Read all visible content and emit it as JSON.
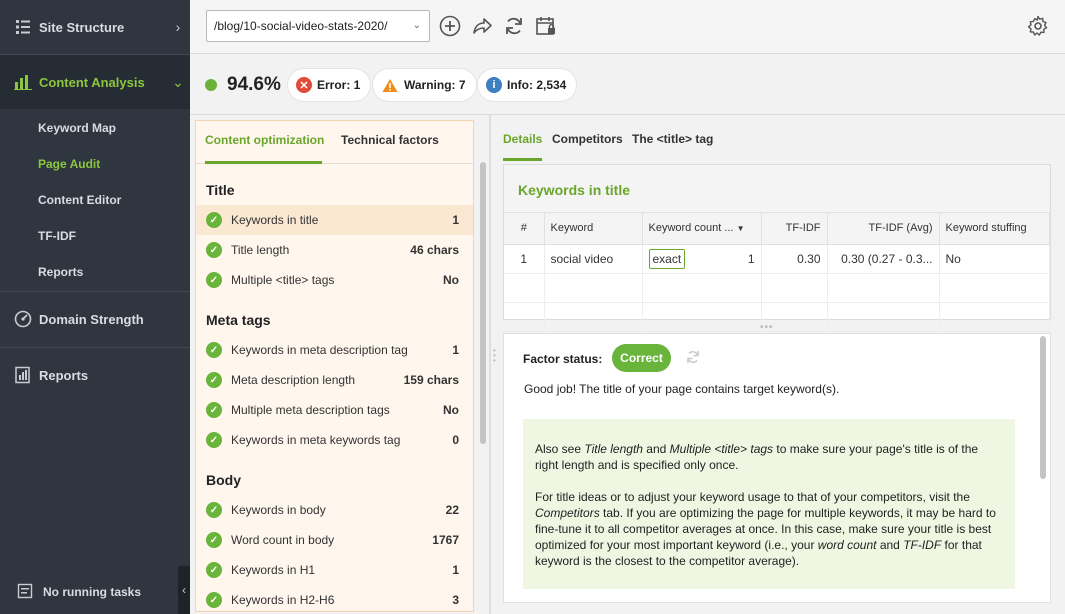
{
  "sidebar": {
    "site_structure": "Site Structure",
    "content_analysis": "Content Analysis",
    "sub_items": [
      "Keyword Map",
      "Page Audit",
      "Content Editor",
      "TF-IDF",
      "Reports"
    ],
    "domain_strength": "Domain Strength",
    "reports": "Reports",
    "footer": "No running tasks"
  },
  "toolbar": {
    "url": "/blog/10-social-video-stats-2020/"
  },
  "status": {
    "score": "94.6%",
    "error": "Error: 1",
    "warning": "Warning: 7",
    "info": "Info: 2,534"
  },
  "left_panel": {
    "tabs": [
      "Content optimization",
      "Technical factors"
    ],
    "sections": [
      {
        "title": "Title",
        "factors": [
          {
            "name": "Keywords in title",
            "value": "1"
          },
          {
            "name": "Title length",
            "value": "46 chars"
          },
          {
            "name": "Multiple <title> tags",
            "value": "No"
          }
        ]
      },
      {
        "title": "Meta tags",
        "factors": [
          {
            "name": "Keywords in meta description tag",
            "value": "1"
          },
          {
            "name": "Meta description length",
            "value": "159 chars"
          },
          {
            "name": "Multiple meta description tags",
            "value": "No"
          },
          {
            "name": "Keywords in meta keywords tag",
            "value": "0"
          }
        ]
      },
      {
        "title": "Body",
        "factors": [
          {
            "name": "Keywords in body",
            "value": "22"
          },
          {
            "name": "Word count in body",
            "value": "1767"
          },
          {
            "name": "Keywords in H1",
            "value": "1"
          },
          {
            "name": "Keywords in H2-H6",
            "value": "3"
          }
        ]
      }
    ]
  },
  "right_panel": {
    "tabs": [
      "Details",
      "Competitors",
      "The <title> tag"
    ],
    "kw_title": "Keywords in title",
    "table": {
      "headers": [
        "#",
        "Keyword",
        "Keyword count ...",
        "TF-IDF",
        "TF-IDF (Avg)",
        "Keyword stuffing"
      ],
      "row": {
        "num": "1",
        "keyword": "social video",
        "match": "exact",
        "count": "1",
        "tfidf": "0.30",
        "tfidf_avg": "0.30 (0.27 - 0.3...",
        "stuffing": "No"
      }
    },
    "factor_status_label": "Factor status:",
    "factor_status": "Correct",
    "good_job": "Good job! The title of your page contains target keyword(s).",
    "tip": {
      "p1_a": "Also see ",
      "p1_i1": "Title length",
      "p1_b": " and ",
      "p1_i2": "Multiple <title> tags",
      "p1_c": " to make sure your page's title is of the right length and is specified only once.",
      "p2_a": "For title ideas or to adjust your keyword usage to that of your competitors, visit the ",
      "p2_i1": "Competitors",
      "p2_b": " tab. If you are optimizing the page for multiple keywords, it may be hard to fine-tune it to all competitor averages at once. In this case, make sure your title is best optimized for your most important keyword (i.e., your ",
      "p2_i2": "word count",
      "p2_c": " and ",
      "p2_i3": "TF-IDF",
      "p2_d": " for that keyword is the closest to the competitor average)."
    }
  },
  "colors": {
    "accent": "#6aa62b",
    "sidebar_bg": "#2f3640",
    "error": "#e04b3a",
    "warning": "#f08c1a",
    "info": "#3d7fc1"
  },
  "icons": [
    "site-structure-icon",
    "content-analysis-icon",
    "domain-strength-icon",
    "reports-icon",
    "tasks-icon",
    "add-icon",
    "share-icon",
    "refresh-icon",
    "calendar-icon",
    "settings-icon"
  ]
}
